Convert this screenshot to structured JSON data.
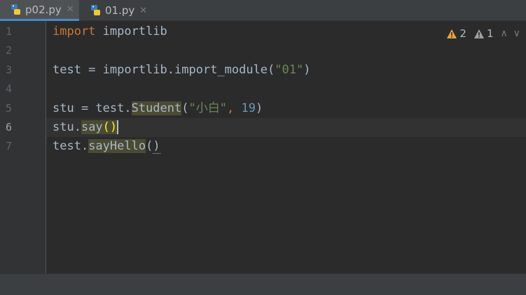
{
  "tabs": [
    {
      "label": "p02.py",
      "active": true,
      "icon": "python-file-icon"
    },
    {
      "label": "01.py",
      "active": false,
      "icon": "python-file-icon"
    }
  ],
  "editor": {
    "line_numbers": [
      "1",
      "2",
      "3",
      "4",
      "5",
      "6",
      "7"
    ],
    "current_line": 6,
    "lines": {
      "l1": {
        "kw": "import",
        "rest": " importlib"
      },
      "l3": {
        "a": "test = importlib.import_module(",
        "s": "\"01\"",
        "b": ")"
      },
      "l5": {
        "a": "stu = test.",
        "cls": "Student",
        "p": "(",
        "s": "\"小白\"",
        "c": ", ",
        "n": "19",
        "e": ")"
      },
      "l6": {
        "a": "stu.",
        "m": "say",
        "p": "()"
      },
      "l7": {
        "a": "test.",
        "m": "sayHello",
        "p": "(",
        "q": ")"
      }
    }
  },
  "inspections": {
    "warnings": "2",
    "weak_warnings": "1",
    "colors": {
      "warning": "#e8a33e",
      "weak_warning": "#a0a0a0"
    }
  },
  "colors": {
    "keyword": "#cc7832",
    "string": "#6a8759",
    "number": "#6897bb",
    "text": "#a9b7c6"
  }
}
